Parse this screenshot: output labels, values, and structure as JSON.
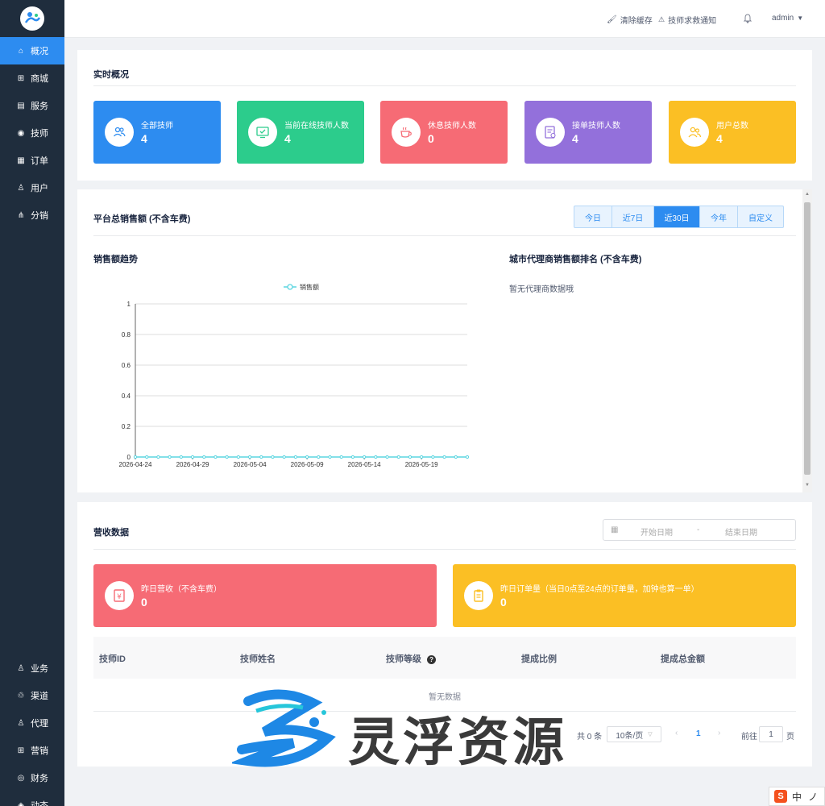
{
  "sidebar": {
    "items": [
      {
        "label": "概况",
        "icon": "home-icon"
      },
      {
        "label": "商城",
        "icon": "shop-icon"
      },
      {
        "label": "服务",
        "icon": "service-icon"
      },
      {
        "label": "技师",
        "icon": "technician-icon"
      },
      {
        "label": "订单",
        "icon": "order-icon"
      },
      {
        "label": "用户",
        "icon": "user-icon"
      },
      {
        "label": "分销",
        "icon": "distribution-icon"
      }
    ],
    "bottom_items": [
      {
        "label": "业务",
        "icon": "business-icon"
      },
      {
        "label": "渠道",
        "icon": "channel-icon"
      },
      {
        "label": "代理",
        "icon": "agent-icon"
      },
      {
        "label": "营销",
        "icon": "marketing-icon"
      },
      {
        "label": "财务",
        "icon": "finance-icon"
      },
      {
        "label": "动态",
        "icon": "dynamic-icon"
      }
    ],
    "active_index": 0
  },
  "header": {
    "clear_cache": "清除缓存",
    "tech_help": "技师求救通知",
    "user": "admin"
  },
  "realtime": {
    "title": "实时概况",
    "stats": [
      {
        "label": "全部技师",
        "value": "4",
        "color": "#2d8cf0",
        "icon": "users-icon"
      },
      {
        "label": "当前在线技师人数",
        "value": "4",
        "color": "#2ccc8c",
        "icon": "monitor-check-icon"
      },
      {
        "label": "休息技师人数",
        "value": "0",
        "color": "#f66b75",
        "icon": "coffee-icon"
      },
      {
        "label": "接单技师人数",
        "value": "4",
        "color": "#9370db",
        "icon": "document-check-icon"
      },
      {
        "label": "用户总数",
        "value": "4",
        "color": "#fbbf24",
        "icon": "user-group-icon"
      }
    ]
  },
  "sales": {
    "title": "平台总销售额 (不含车费)",
    "tabs": [
      "今日",
      "近7日",
      "近30日",
      "今年",
      "自定义"
    ],
    "active_tab": 2,
    "trend_title": "销售额趋势",
    "ranking_title": "城市代理商销售额排名 (不含车费)",
    "ranking_empty": "暂无代理商数据哦"
  },
  "chart_data": {
    "type": "line",
    "title": "",
    "xlabel": "",
    "ylabel": "",
    "legend_position": "top-center",
    "grid": true,
    "ylim": [
      0,
      1
    ],
    "yticks": [
      "0",
      "0.2",
      "0.4",
      "0.6",
      "0.8",
      "1"
    ],
    "xticks": [
      "2026-04-24",
      "2026-04-29",
      "2026-05-04",
      "2026-05-09",
      "2026-05-14",
      "2026-05-19"
    ],
    "x": [
      "2026-04-24",
      "2026-04-25",
      "2026-04-26",
      "2026-04-27",
      "2026-04-28",
      "2026-04-29",
      "2026-04-30",
      "2026-05-01",
      "2026-05-02",
      "2026-05-03",
      "2026-05-04",
      "2026-05-05",
      "2026-05-06",
      "2026-05-07",
      "2026-05-08",
      "2026-05-09",
      "2026-05-10",
      "2026-05-11",
      "2026-05-12",
      "2026-05-13",
      "2026-05-14",
      "2026-05-15",
      "2026-05-16",
      "2026-05-17",
      "2026-05-18",
      "2026-05-19",
      "2026-05-20",
      "2026-05-21",
      "2026-05-22",
      "2026-05-23"
    ],
    "series": [
      {
        "name": "销售额",
        "color": "#5bd5e0",
        "values": [
          0,
          0,
          0,
          0,
          0,
          0,
          0,
          0,
          0,
          0,
          0,
          0,
          0,
          0,
          0,
          0,
          0,
          0,
          0,
          0,
          0,
          0,
          0,
          0,
          0,
          0,
          0,
          0,
          0,
          0
        ]
      }
    ]
  },
  "revenue": {
    "title": "营收数据",
    "start_placeholder": "开始日期",
    "separator": "-",
    "end_placeholder": "结束日期",
    "yesterday_revenue_label": "昨日营收（不含车费）",
    "yesterday_revenue_value": "0",
    "yesterday_orders_label": "昨日订单量（当日0点至24点的订单量，加钟也算一单）",
    "yesterday_orders_value": "0",
    "table_headers": [
      "技师ID",
      "技师姓名",
      "技师等级",
      "提成比例",
      "提成总金额"
    ],
    "empty": "暂无数据",
    "pagination": {
      "total": "共 0 条",
      "page_size": "10条/页",
      "current": "1",
      "goto_label": "前往",
      "goto_value": "1",
      "page_suffix": "页"
    }
  },
  "watermark_text": "灵浮资源",
  "ime": {
    "label": "中",
    "extra": "ノ"
  }
}
